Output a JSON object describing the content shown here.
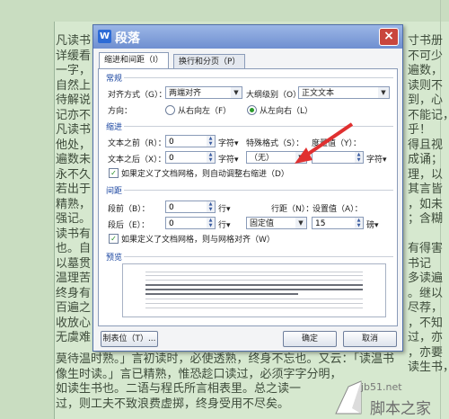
{
  "document": {
    "lines_left": [
      "凡读书",
      "详缓看",
      "一字，",
      "自然上",
      "待解说",
      "记亦不",
      "凡读书",
      "他处，",
      "遍数未",
      "永不久",
      "若出于",
      "精熟，",
      "强记。",
      "读书有",
      "也。自",
      "以墓贯",
      "温理苦",
      "终身有",
      "百遍之",
      "收放心",
      "无虞难"
    ],
    "lines_right": [
      "寸书册",
      "不可少",
      "遍数，",
      "读则不",
      "到，心",
      "不能记，",
      "乎！",
      "得且视",
      "成诵；",
      "理，以",
      "其言皆",
      "，如未",
      "；含糊",
      "",
      "有得害",
      "书记",
      "多读遍",
      "。继以",
      "尽荐，",
      "，不知",
      "过，亦",
      "，亦要",
      "读生书，"
    ],
    "bottom_lines": [
      "莫待温时熟。」言初读时，必使透熟，终身不忘也。又云：「读温书",
      "像生时读。」言已精熟，惟恐趁口读过，必须字字分明，",
      "如读生书也。二语与程氏所言相表里。总之读一",
      "过，则工夫不致浪费虚掷，终身受用不尽矣。"
    ]
  },
  "dialog": {
    "title": "段落",
    "close_glyph": "×",
    "tabs": [
      "缩进和间距（I）",
      "换行和分页（P）"
    ],
    "general": {
      "section": "常规",
      "align_label": "对齐方式（G）：",
      "align_value": "两端对齐",
      "outline_label": "大纲级别（O）：",
      "outline_value": "正文文本",
      "direction_label": "方向：",
      "rtl_label": "从右向左（F）",
      "ltr_label": "从左向右（L）"
    },
    "indent": {
      "section": "缩进",
      "before_label": "文本之前（R）：",
      "before_value": "0",
      "before_unit": "字符▾",
      "special_label": "特殊格式（S）：",
      "special_value": "（无）",
      "measure_label": "度量值（Y）：",
      "measure_value": "",
      "measure_unit": "字符▾",
      "after_label": "文本之后（X）：",
      "after_value": "0",
      "after_unit": "字符▾",
      "grid_check_label": "如果定义了文档网格，则自动调整右缩进（D）"
    },
    "spacing": {
      "section": "间距",
      "before_label": "段前（B）：",
      "before_value": "0",
      "before_unit": "行▾",
      "line_label": "行距（N）：",
      "line_value": "固定值",
      "setting_label": "设置值（A）：",
      "setting_value": "15",
      "setting_unit": "磅▾",
      "after_label": "段后（E）：",
      "after_value": "0",
      "after_unit": "行▾",
      "grid_check_label": "如果定义了文档网格，则与网格对齐（W）"
    },
    "preview_label": "预览",
    "buttons": {
      "tabs": "制表位（T）...",
      "ok": "确定",
      "cancel": "取消"
    }
  },
  "watermark": {
    "domain": "jb51.net",
    "name": "脚本之家"
  },
  "colors": {
    "document_bg": "#d6e8cf",
    "dialog_title": "#6f8fd0",
    "arrow": "#e03030"
  }
}
